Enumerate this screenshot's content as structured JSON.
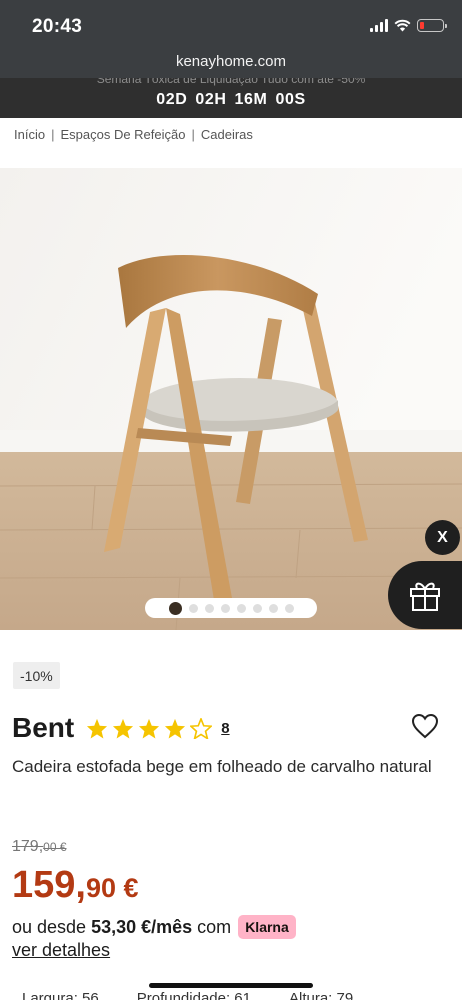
{
  "status_bar": {
    "time": "20:43",
    "icons": [
      "signal-icon",
      "wifi-icon",
      "battery-icon"
    ],
    "battery_color": "#ff3b30"
  },
  "browser": {
    "url": "kenayhome.com"
  },
  "banner": {
    "promo_text": "Semana Tóxica de Liquidação Tudo com até -50%",
    "countdown": {
      "days": "02D",
      "hours": "02H",
      "minutes": "16M",
      "seconds": "00S"
    }
  },
  "breadcrumb": {
    "items": [
      "Início",
      "Espaços De Refeição",
      "Cadeiras"
    ],
    "separator": "|"
  },
  "gallery": {
    "image_alt": "Cadeira Bent",
    "dot_count": 8,
    "active_index": 0,
    "close_label": "X",
    "gift_icon": "gift-icon"
  },
  "product": {
    "discount_badge": "-10%",
    "name": "Bent",
    "rating": 4,
    "rating_max": 5,
    "review_count": "8",
    "description": "Cadeira estofada bege em folheado de carvalho natural",
    "old_price_int": "179,",
    "old_price_rest": "00 €",
    "price_int": "159,",
    "price_rest": "90 €",
    "price_color": "#b33a13",
    "financing_prefix": "ou desde",
    "financing_amount": "53,30 €/mês",
    "financing_suffix": "com",
    "klarna_label": "Klarna",
    "klarna_color": "#ffb3c7",
    "details_link": "ver detalhes"
  },
  "dimensions": [
    "Largura: 56",
    "Profundidade: 61",
    "Altura: 79"
  ]
}
